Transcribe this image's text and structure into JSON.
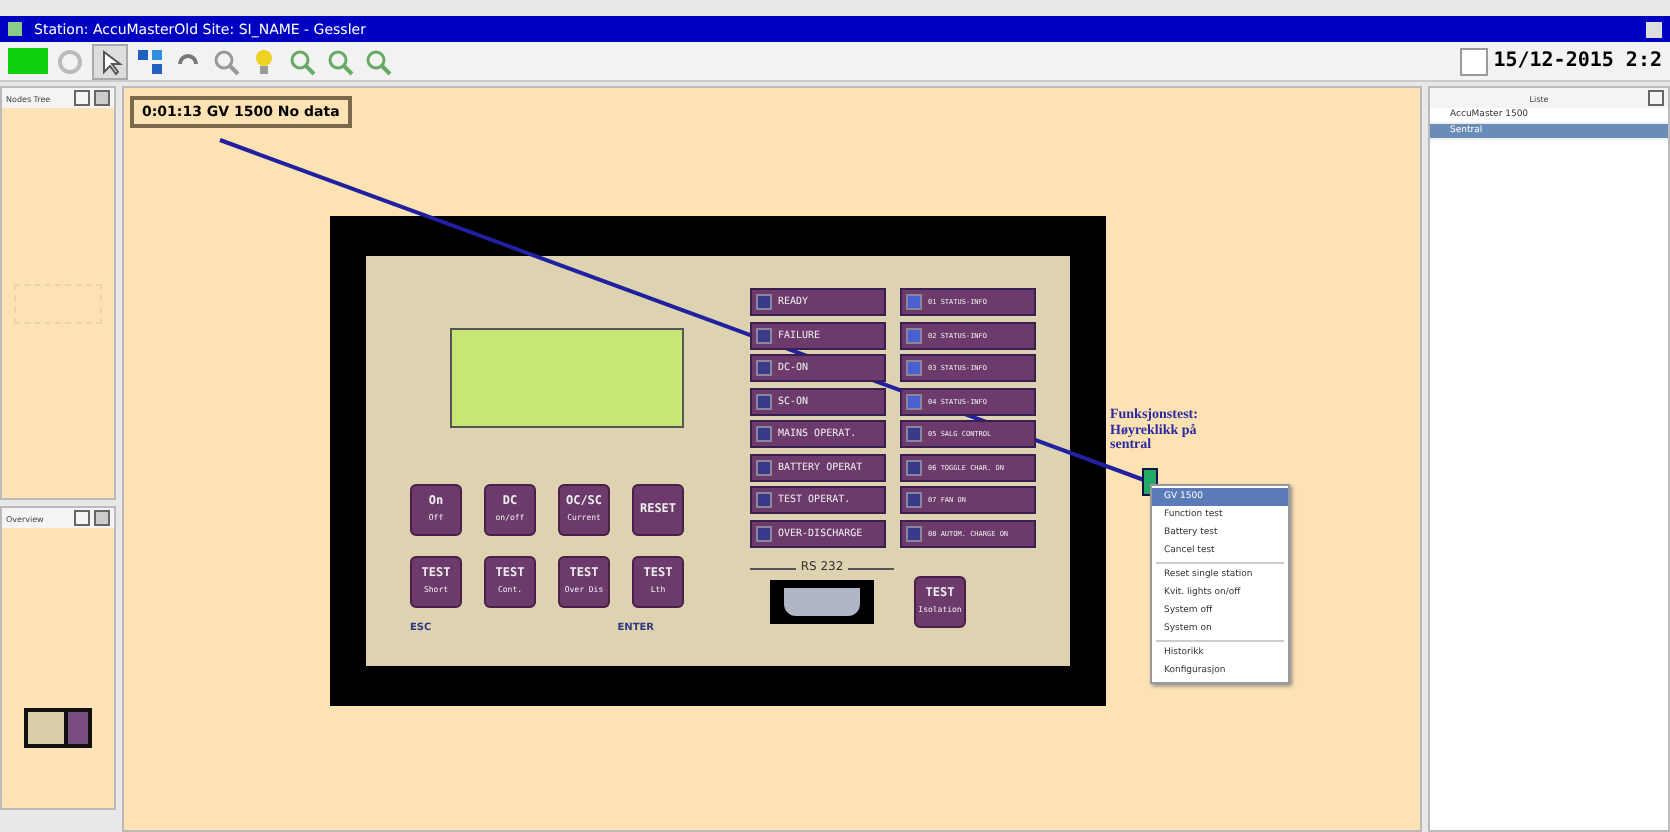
{
  "window": {
    "title": "Station: AccuMasterOld    Site: SI_NAME - Gessler"
  },
  "toolbar": {
    "checked": false,
    "datetime": "15/12-2015 2:2"
  },
  "left_panels": [
    {
      "title": "Nodes  Tree"
    },
    {
      "title": "Overview"
    }
  ],
  "status_box": {
    "text": "0:01:13   GV 1500 No data"
  },
  "device": {
    "indicators_left": [
      {
        "label": "READY",
        "on": false
      },
      {
        "label": "FAILURE",
        "on": false
      },
      {
        "label": "DC-ON",
        "on": false
      },
      {
        "label": "SC-ON",
        "on": false
      },
      {
        "label": "MAINS OPERAT.",
        "on": false
      },
      {
        "label": "BATTERY OPERAT",
        "on": false
      },
      {
        "label": "TEST OPERAT.",
        "on": false
      },
      {
        "label": "OVER-DISCHARGE",
        "on": false
      }
    ],
    "indicators_right": [
      {
        "label": "01 STATUS-INFO",
        "on": true
      },
      {
        "label": "02 STATUS-INFO",
        "on": true
      },
      {
        "label": "03 STATUS-INFO",
        "on": true
      },
      {
        "label": "04 STATUS-INFO",
        "on": true
      },
      {
        "label": "05 SALG CONTROL",
        "on": false
      },
      {
        "label": "06 TOGGLE CHAR. ON",
        "on": false
      },
      {
        "label": "07 FAN ON",
        "on": false
      },
      {
        "label": "08 AUTOM. CHARGE ON",
        "on": false
      }
    ],
    "keys": [
      {
        "top": "On",
        "bottom": "Off"
      },
      {
        "top": "DC",
        "bottom": "on/off"
      },
      {
        "top": "OC/SC",
        "bottom": "Current"
      },
      {
        "top": "RESET"
      },
      {
        "top": "TEST",
        "bottom": "Short"
      },
      {
        "top": "TEST",
        "bottom": "Cont."
      },
      {
        "top": "TEST",
        "bottom": "Over Dis"
      },
      {
        "top": "TEST",
        "bottom": "Lth"
      }
    ],
    "key_labels": [
      "ESC",
      "ENTER"
    ],
    "port_label": "RS 232",
    "isolation_key": {
      "top": "TEST",
      "bottom": "Isolation"
    }
  },
  "hint": "Funksjonstest: Høyreklikk på sentral",
  "context_menu": [
    {
      "label": "GV 1500",
      "selected": true
    },
    {
      "label": "Function test",
      "selected": false
    },
    {
      "label": "Battery test",
      "selected": false
    },
    {
      "label": "Cancel test",
      "selected": false
    },
    {
      "label": "Reset single station",
      "selected": false
    },
    {
      "label": "Kvit. lights on/off",
      "selected": false
    },
    {
      "label": "System off",
      "selected": false
    },
    {
      "label": "System on",
      "selected": false
    },
    {
      "label": "Historikk",
      "selected": false
    },
    {
      "label": "Konfigurasjon",
      "selected": false
    }
  ],
  "right_panel": {
    "title": "Liste",
    "items": [
      {
        "label": "AccuMaster 1500",
        "selected": false
      },
      {
        "label": "Sentral",
        "selected": true
      }
    ]
  }
}
